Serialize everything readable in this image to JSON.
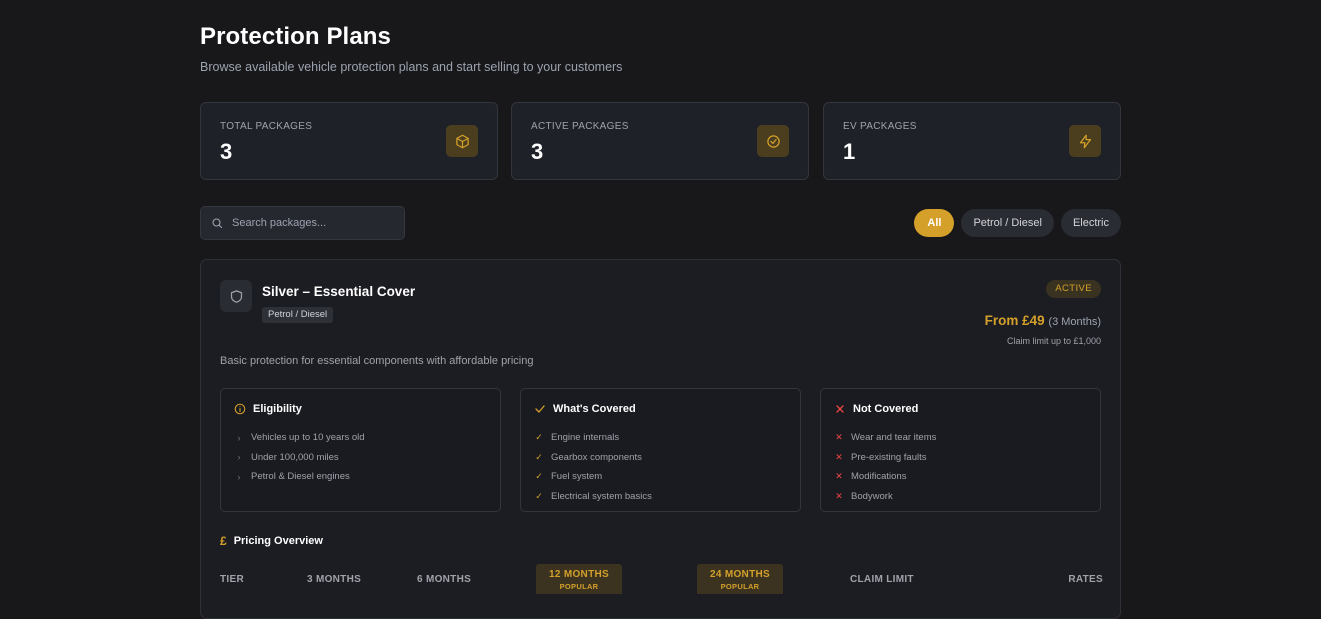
{
  "header": {
    "title": "Protection Plans",
    "subtitle": "Browse available vehicle protection plans and start selling to your customers"
  },
  "stats": [
    {
      "label": "TOTAL PACKAGES",
      "value": "3",
      "icon": "box-icon"
    },
    {
      "label": "ACTIVE PACKAGES",
      "value": "3",
      "icon": "check-circle-icon"
    },
    {
      "label": "EV PACKAGES",
      "value": "1",
      "icon": "lightning-icon"
    }
  ],
  "search": {
    "placeholder": "Search packages...",
    "value": ""
  },
  "filters": [
    {
      "label": "All",
      "active": true
    },
    {
      "label": "Petrol / Diesel",
      "active": false
    },
    {
      "label": "Electric",
      "active": false
    }
  ],
  "package": {
    "name": "Silver – Essential Cover",
    "fuel_tag": "Petrol / Diesel",
    "status": "ACTIVE",
    "price": "From £49",
    "price_term": "(3 Months)",
    "claim_limit": "Claim limit up to £1,000",
    "description": "Basic protection for essential components with affordable pricing",
    "eligibility": {
      "title": "Eligibility",
      "items": [
        "Vehicles up to 10 years old",
        "Under 100,000 miles",
        "Petrol & Diesel engines"
      ]
    },
    "covered": {
      "title": "What's Covered",
      "items": [
        "Engine internals",
        "Gearbox components",
        "Fuel system",
        "Electrical system basics"
      ]
    },
    "not_covered": {
      "title": "Not Covered",
      "items": [
        "Wear and tear items",
        "Pre-existing faults",
        "Modifications",
        "Bodywork"
      ]
    },
    "pricing": {
      "title": "Pricing Overview",
      "currency_symbol": "£",
      "columns": {
        "tier": "TIER",
        "m3": "3 MONTHS",
        "m6": "6 MONTHS",
        "m12": "12 MONTHS",
        "m24": "24 MONTHS",
        "popular": "POPULAR",
        "claim_limit": "CLAIM LIMIT",
        "rates": "RATES"
      }
    }
  },
  "colors": {
    "accent": "#d4a02a",
    "background": "#18181b",
    "card": "#1f2128",
    "danger": "#ef4444"
  }
}
